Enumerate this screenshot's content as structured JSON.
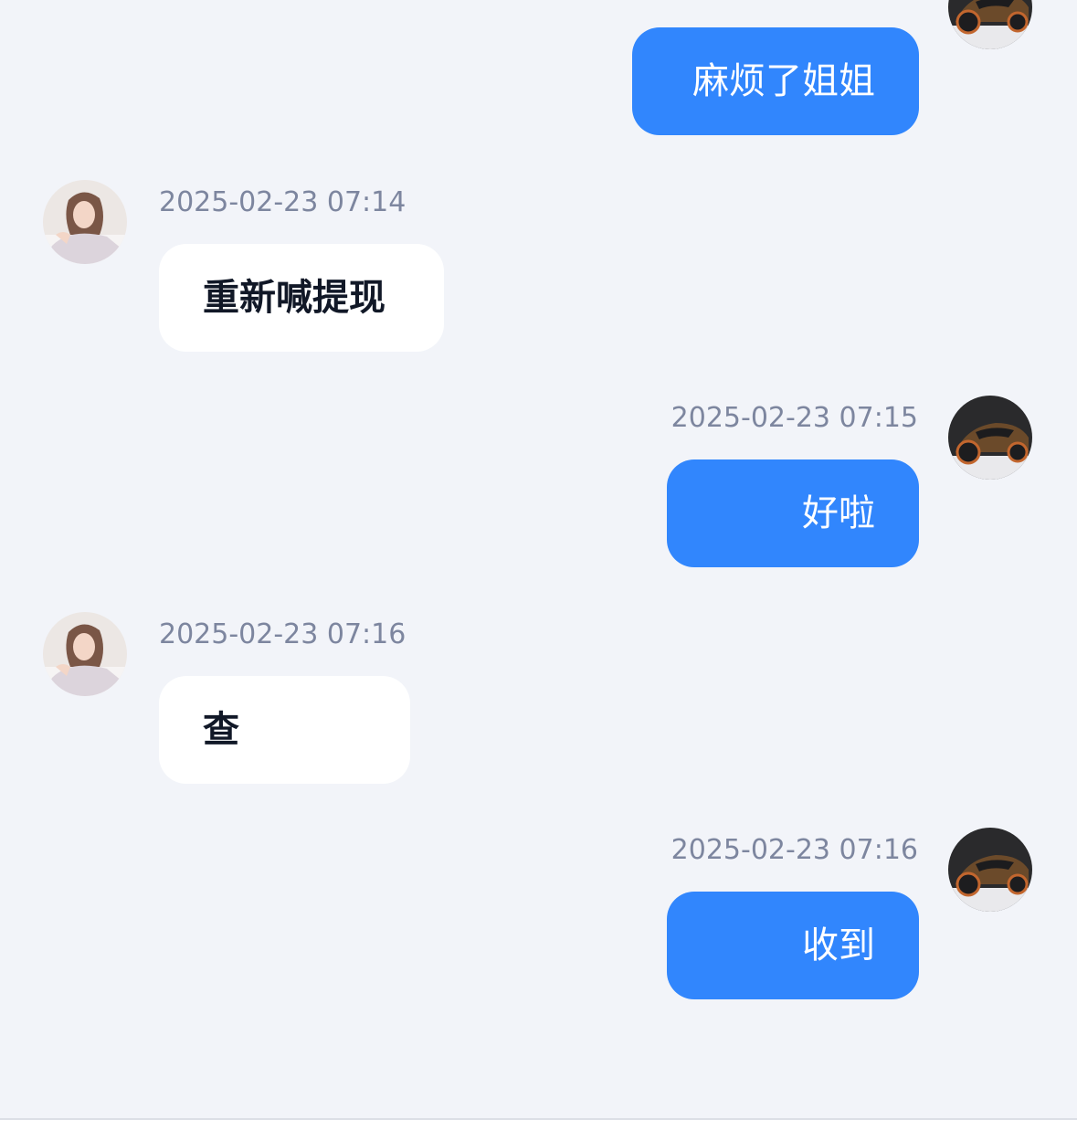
{
  "colors": {
    "background": "#f2f4f9",
    "incoming_bubble": "#ffffff",
    "outgoing_bubble": "#3186fd",
    "timestamp": "#7d869f"
  },
  "messages": [
    {
      "direction": "outgoing",
      "time": "",
      "text": "麻烦了姐姐",
      "avatar": "car-avatar"
    },
    {
      "direction": "incoming",
      "time": "2025-02-23 07:14",
      "text": "重新喊提现",
      "avatar": "girl-avatar"
    },
    {
      "direction": "outgoing",
      "time": "2025-02-23 07:15",
      "text": "好啦",
      "avatar": "car-avatar"
    },
    {
      "direction": "incoming",
      "time": "2025-02-23 07:16",
      "text": "查",
      "avatar": "girl-avatar"
    },
    {
      "direction": "outgoing",
      "time": "2025-02-23 07:16",
      "text": "收到",
      "avatar": "car-avatar"
    }
  ]
}
